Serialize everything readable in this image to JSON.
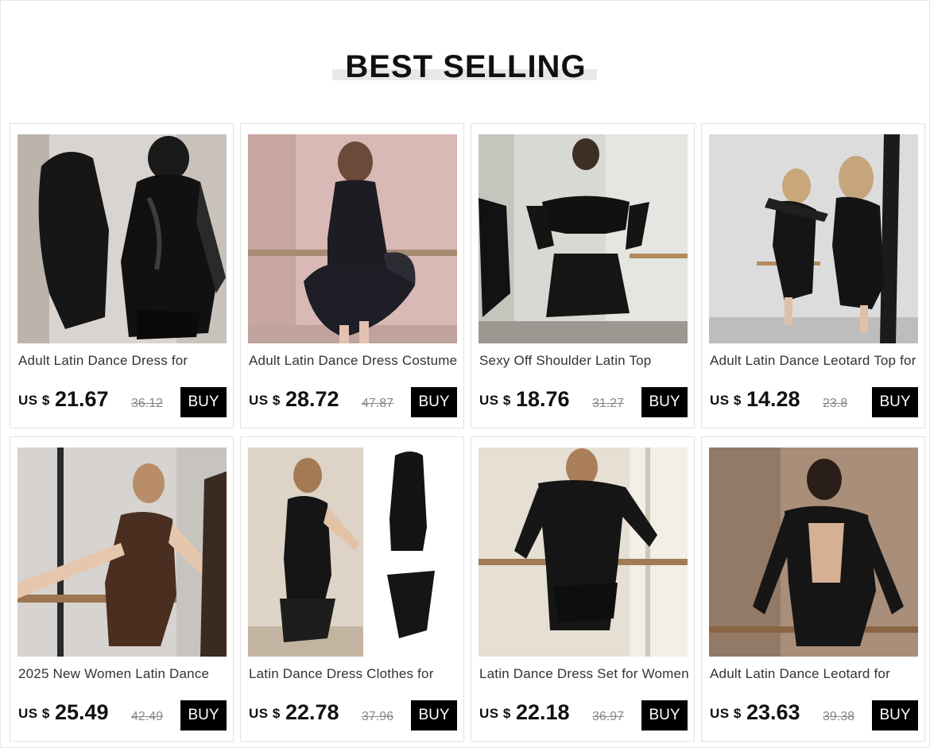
{
  "section": {
    "title": "BEST SELLING"
  },
  "colors": {
    "buy_button": "#000000",
    "old_price": "#888888",
    "title_underline": "#e8e8e8"
  },
  "products": [
    {
      "name": "Adult Latin Dance Dress for",
      "currency": "US $",
      "price": "21.67",
      "old_price": "36.12",
      "buy_label": "BUY",
      "image": "black-lace-mesh-dress-photo"
    },
    {
      "name": "Adult Latin Dance Dress Costume",
      "currency": "US $",
      "price": "28.72",
      "old_price": "47.87",
      "buy_label": "BUY",
      "image": "black-halter-ruffle-dress-photo"
    },
    {
      "name": "Sexy Off Shoulder Latin Top",
      "currency": "US $",
      "price": "18.76",
      "old_price": "31.27",
      "buy_label": "BUY",
      "image": "off-shoulder-crop-top-photo"
    },
    {
      "name": "Adult Latin Dance Leotard Top for",
      "currency": "US $",
      "price": "14.28",
      "old_price": "23.8",
      "buy_label": "BUY",
      "image": "black-mesh-leotard-photo"
    },
    {
      "name": "2025 New Women Latin Dance",
      "currency": "US $",
      "price": "25.49",
      "old_price": "42.49",
      "buy_label": "BUY",
      "image": "brown-drape-dress-photo"
    },
    {
      "name": "Latin Dance Dress Clothes for",
      "currency": "US $",
      "price": "22.78",
      "old_price": "37.96",
      "buy_label": "BUY",
      "image": "halter-romper-and-skirt-photo"
    },
    {
      "name": "Latin Dance Dress Set for Women",
      "currency": "US $",
      "price": "22.18",
      "old_price": "36.97",
      "buy_label": "BUY",
      "image": "off-shoulder-fringe-set-photo"
    },
    {
      "name": "Adult Latin Dance Leotard for",
      "currency": "US $",
      "price": "23.63",
      "old_price": "39.38",
      "buy_label": "BUY",
      "image": "open-back-leotard-photo"
    }
  ]
}
